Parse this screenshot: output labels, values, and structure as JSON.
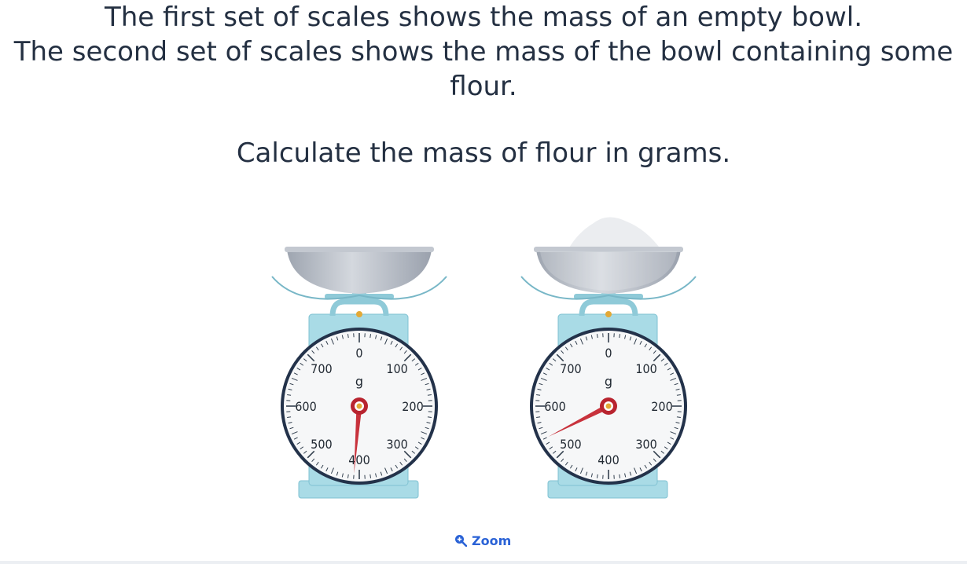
{
  "question": {
    "line1": "The first set of scales shows the mass of an empty bowl.",
    "line2": "The second set of scales shows the mass of the bowl containing some",
    "line3": "flour.",
    "task": "Calculate the mass of flour in grams."
  },
  "scales": [
    {
      "name": "empty-bowl",
      "reading_g": 410,
      "has_flour": false
    },
    {
      "name": "bowl-with-flour",
      "reading_g": 540,
      "has_flour": true
    }
  ],
  "dial": {
    "labels": [
      "0",
      "100",
      "200",
      "300",
      "400",
      "500",
      "600",
      "700"
    ],
    "unit": "g",
    "max_g": 800
  },
  "zoom": {
    "label": "Zoom",
    "icon": "zoom-in-icon"
  },
  "colors": {
    "text": "#243042",
    "scale_body": "#a9dbe6",
    "scale_dark": "#7fc2d2",
    "bowl": "#bcc2cc",
    "needle": "#c8323c",
    "accent": "#2a62d6"
  }
}
